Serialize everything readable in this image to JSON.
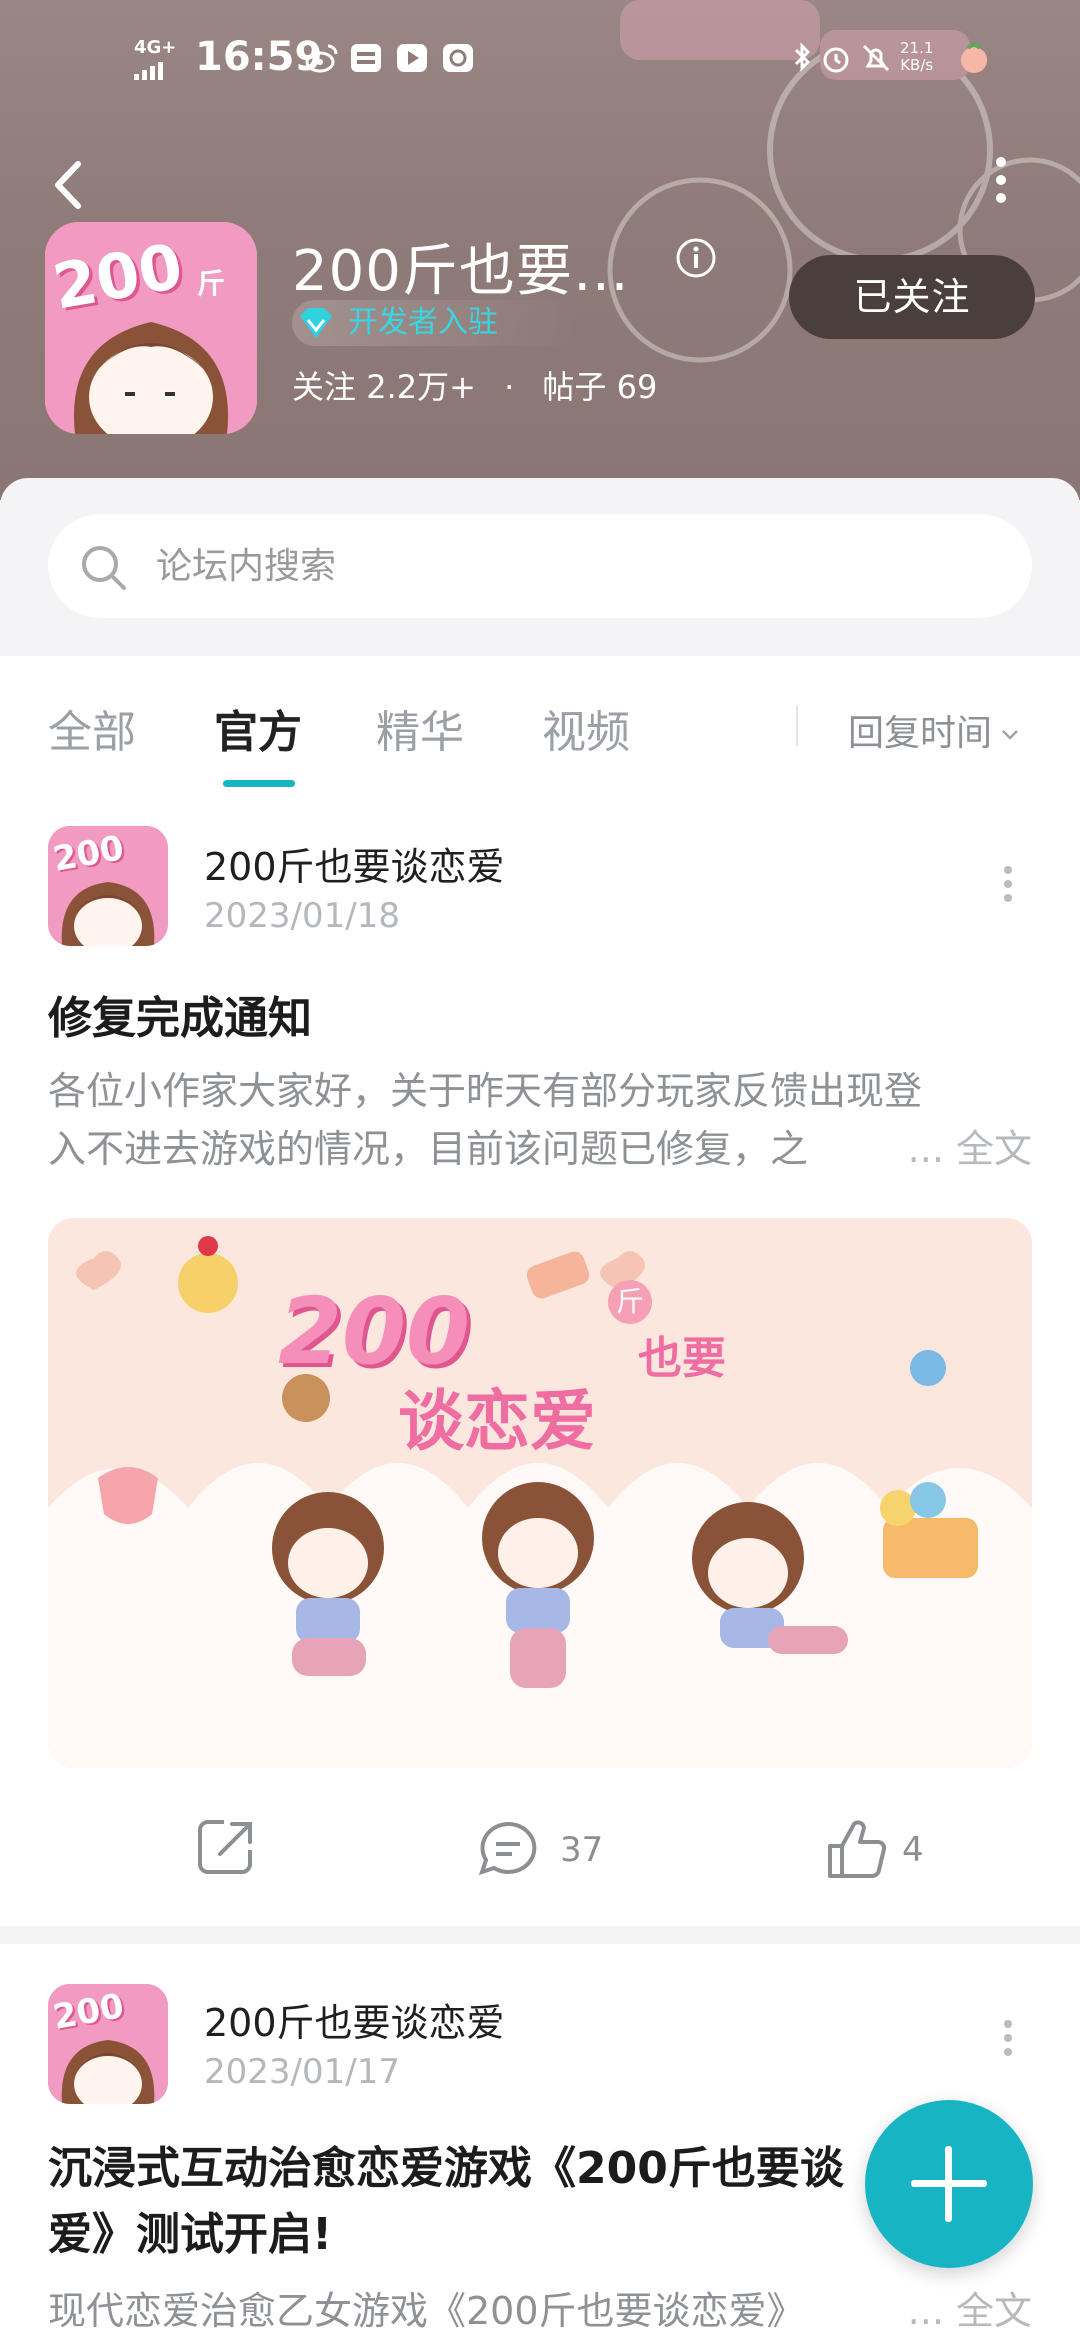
{
  "status_bar": {
    "network": "4G+",
    "time": "16:59",
    "speed_value": "21.1",
    "speed_unit": "KB/s"
  },
  "header": {
    "title": "200斤也要…",
    "developer_badge": "开发者入驻",
    "followers_label": "关注",
    "followers_count": "2.2万+",
    "separator": "·",
    "posts_label": "帖子",
    "posts_count": "69",
    "follow_button": "已关注",
    "app_icon_text": "200",
    "app_icon_sub": "斤"
  },
  "search": {
    "placeholder": "论坛内搜索"
  },
  "tabs": {
    "items": [
      "全部",
      "官方",
      "精华",
      "视频"
    ],
    "active": "官方",
    "sort_label": "回复时间"
  },
  "posts": [
    {
      "author": "200斤也要谈恋爱",
      "date": "2023/01/18",
      "title": "修复完成通知",
      "body_line1": "各位小作家大家好，关于昨天有部分玩家反馈出现登",
      "body_line2": "入不进去游戏的情况，目前该问题已修复，之",
      "more_text": "... 全文",
      "banner_text_main": "200",
      "banner_text_jin": "斤",
      "banner_text_ye": "也要",
      "banner_text_bottom": "谈恋爱",
      "comments": "37",
      "likes": "4"
    },
    {
      "author": "200斤也要谈恋爱",
      "date": "2023/01/17",
      "title_line1": "沉浸式互动治愈恋爱游戏《200斤也要谈",
      "title_line2": "爱》测试开启!",
      "body_line1": "现代恋爱治愈乙女游戏《200斤也要谈恋爱》",
      "more_text": "... 全文"
    }
  ],
  "colors": {
    "accent": "#17b4c4",
    "header_bg": "#8f7b78",
    "follow_button_bg": "#4b3f3d",
    "badge_text": "#38d6e2"
  }
}
